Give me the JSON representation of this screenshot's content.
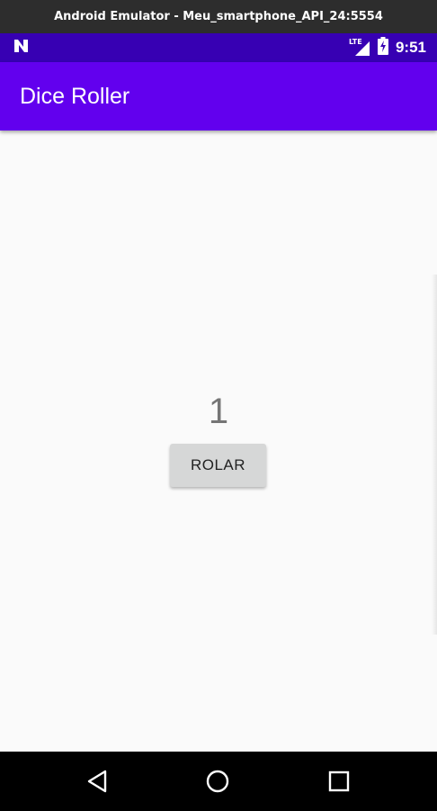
{
  "window": {
    "title": "Android Emulator - Meu_smartphone_API_24:5554"
  },
  "status_bar": {
    "time": "9:51",
    "network_label": "LTE",
    "notification_icon": "android-n-icon",
    "background": "#3700b3"
  },
  "app_bar": {
    "title": "Dice Roller",
    "background": "#6200ee"
  },
  "main": {
    "result": "1",
    "roll_button_label": "ROLAR"
  },
  "nav_bar": {
    "icons": [
      "back-icon",
      "home-icon",
      "recents-icon"
    ]
  }
}
